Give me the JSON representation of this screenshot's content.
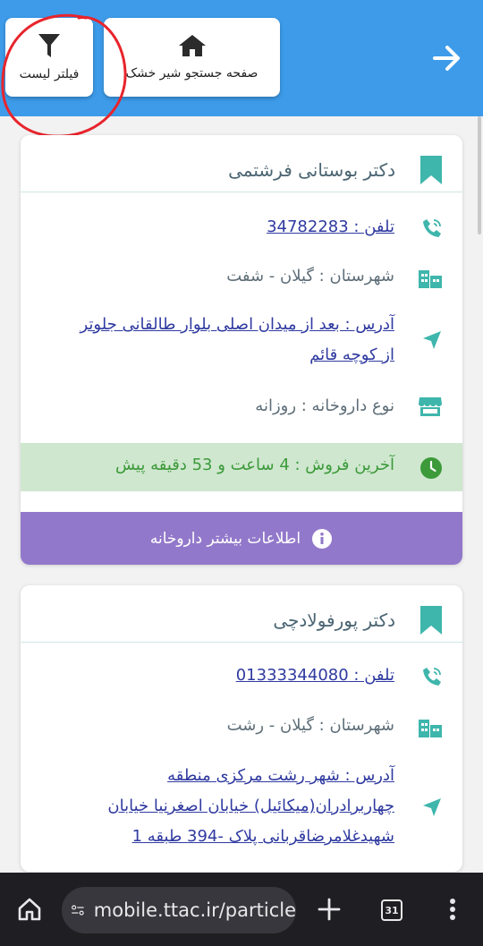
{
  "header": {
    "home_label": "صفحه جستجو شیر خشک",
    "filter_label": "فیلتر لیست",
    "accent_color": "#3d9be9"
  },
  "pharmacies": [
    {
      "name": "دکتر بوستانی فرشتمی",
      "phone": "تلفن : 34782283",
      "city": "شهرستان : گیلان - شفت",
      "address_lines": [
        "آدرس : بعد از میدان اصلی بلوار طالقانی جلوتر",
        "از کوچه قائم"
      ],
      "type": "نوع داروخانه : روزانه",
      "last_sale": "آخرین فروش : 4 ساعت و 53 دقیقه پیش",
      "more_info": "اطلاعات بیشتر داروخانه"
    },
    {
      "name": "دکتر پورفولادچی",
      "phone": "تلفن : 01333344080",
      "city": "شهرستان : گیلان - رشت",
      "address_lines": [
        "آدرس : شهر رشت مرکزی منطقه",
        "چهاربرادران(میکائیل) خیابان اصغرنیا خیابان",
        "شهیدغلامرضاقربانی پلاک -394 طبقه 1"
      ]
    }
  ],
  "colors": {
    "teal_icon": "#3fb6ac",
    "sale_bg": "#cfe7cf",
    "sale_text": "#3c9a3a",
    "more_btn": "#9278ca"
  },
  "browser": {
    "url": "mobile.ttac.ir/particle",
    "tab_count": "31"
  }
}
